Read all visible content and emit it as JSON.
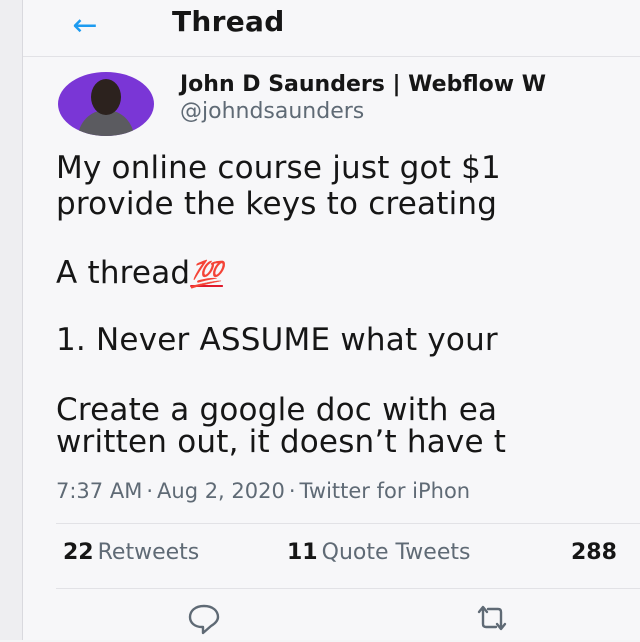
{
  "header": {
    "back_icon": "arrow-left-icon",
    "title": "Thread"
  },
  "tweet": {
    "author_name": "John D Saunders | Webflow W",
    "author_handle": "@johndsaunders",
    "lines": [
      "My online course just got $1",
      "provide the keys to creating",
      "A thread",
      "1. Never ASSUME what your",
      "Create a google doc with ea",
      "written out, it doesn’t have t"
    ],
    "emoji": "💯",
    "time": "7:37 AM",
    "date": "Aug 2, 2020",
    "source": "Twitter for iPhon"
  },
  "stats": [
    {
      "count": "22",
      "label": "Retweets"
    },
    {
      "count": "11",
      "label": "Quote Tweets"
    },
    {
      "count": "288",
      "label": ""
    }
  ],
  "actions": [
    {
      "icon": "reply-icon"
    },
    {
      "icon": "retweet-icon"
    }
  ],
  "colors": {
    "accent": "#1d9bf0",
    "avatar_bg": "#7a36d6",
    "emoji_red": "#e0192c",
    "muted": "#5f6a75"
  }
}
